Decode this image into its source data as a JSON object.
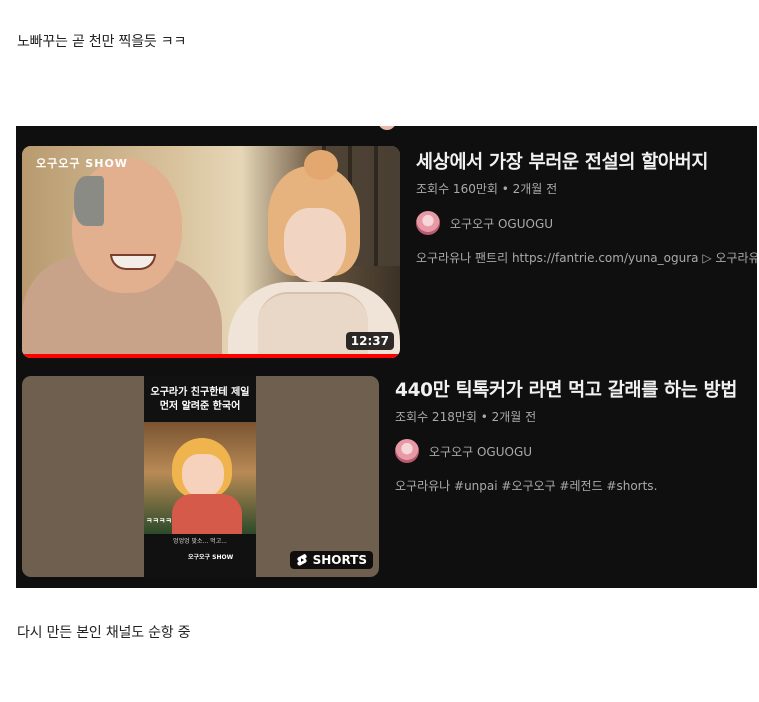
{
  "post": {
    "top_text": "노빠꾸는 곧 천만 찍을듯 ㅋㅋ",
    "bottom_text": "다시 만든 본인 채널도 순항 중"
  },
  "videos": [
    {
      "title": "세상에서 가장 부러운 전설의 할아버지",
      "meta": "조회수 160만회 • 2개월 전",
      "channel": "오구오구 OGUOGU",
      "description": "오구라유나 팬트리 https://fantrie.com/yuna_ogura ▷ 오구라유나",
      "duration": "12:37",
      "thumbnail_logo": "오구오구 SHOW",
      "watch_progress": 1.0
    },
    {
      "title": "440만 틱톡커가 라면 먹고 갈래를 하는 방법",
      "meta": "조회수 218만회 • 2개월 전",
      "channel": "오구오구 OGUOGU",
      "description": "오구라유나 #unpai #오구오구 #레전드 #shorts.",
      "badge": "SHORTS",
      "thumbnail_caption": "오구라가 친구한테 제일 먼저 알려준 한국어",
      "thumbnail_sub1": "ㅋㅋㅋㅋ",
      "thumbnail_sub2": "엉엉엉 맞소... 먹고...",
      "thumbnail_logo": "오구오구 SHOW"
    }
  ],
  "colors": {
    "background": "#0f0f0f",
    "progress": "#ff0000",
    "title": "#f1f1f1",
    "secondary": "#aaaaaa"
  }
}
